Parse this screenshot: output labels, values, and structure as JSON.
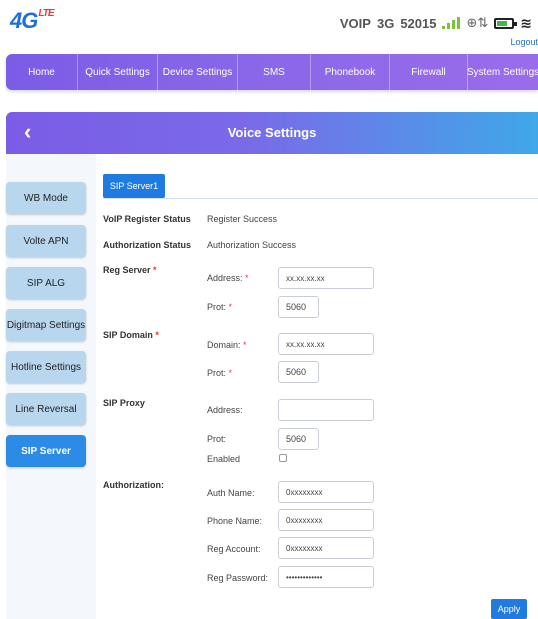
{
  "header": {
    "logo_text": "4G",
    "logo_sub": "LTE",
    "mode": "VOIP",
    "network": "3G",
    "operator": "52015",
    "globe_glyph": "⊕⇅",
    "wifi_glyph": "≋",
    "logout": "Logout"
  },
  "nav": [
    {
      "label": "Home"
    },
    {
      "label": "Quick Settings"
    },
    {
      "label": "Device Settings"
    },
    {
      "label": "SMS"
    },
    {
      "label": "Phonebook"
    },
    {
      "label": "Firewall"
    },
    {
      "label": "System Settings"
    }
  ],
  "page": {
    "back_glyph": "‹",
    "title": "Voice Settings"
  },
  "sidebar": [
    {
      "label": "WB Mode"
    },
    {
      "label": "Volte APN"
    },
    {
      "label": "SIP ALG"
    },
    {
      "label": "Digitmap Settings"
    },
    {
      "label": "Hotline Settings"
    },
    {
      "label": "Line Reversal"
    },
    {
      "label": "SIP Server",
      "active": true
    }
  ],
  "tab": {
    "label": "SIP Server1"
  },
  "status": {
    "voip_label": "VoIP Register Status",
    "voip_value": "Register Success",
    "auth_label": "Authorization Status",
    "auth_value": "Authorization Success"
  },
  "reg_server": {
    "label": "Reg Server",
    "address_label": "Address:",
    "address_value": "xx.xx.xx.xx",
    "port_label": "Prot:",
    "port_value": "5060"
  },
  "sip_domain": {
    "label": "SIP Domain",
    "domain_label": "Domain:",
    "domain_value": "xx.xx.xx.xx",
    "port_label": "Prot:",
    "port_value": "5060"
  },
  "sip_proxy": {
    "label": "SIP Proxy",
    "address_label": "Address:",
    "address_value": "",
    "port_label": "Prot:",
    "port_value": "5060",
    "enabled_label": "Enabled"
  },
  "authorization": {
    "label": "Authorization:",
    "auth_name_label": "Auth Name:",
    "auth_name_value": "0xxxxxxxx",
    "phone_name_label": "Phone Name:",
    "phone_name_value": "0xxxxxxxx",
    "reg_account_label": "Reg Account:",
    "reg_account_value": "0xxxxxxxx",
    "reg_password_label": "Reg Password:",
    "reg_password_value": "•••••••••••••"
  },
  "apply_label": "Apply",
  "required_mark": "*",
  "colors": {
    "accent": "#1f7be0",
    "nav_start": "#7b5ce6",
    "sidebar_item": "#b8d7ee",
    "required": "#e23b3b"
  }
}
